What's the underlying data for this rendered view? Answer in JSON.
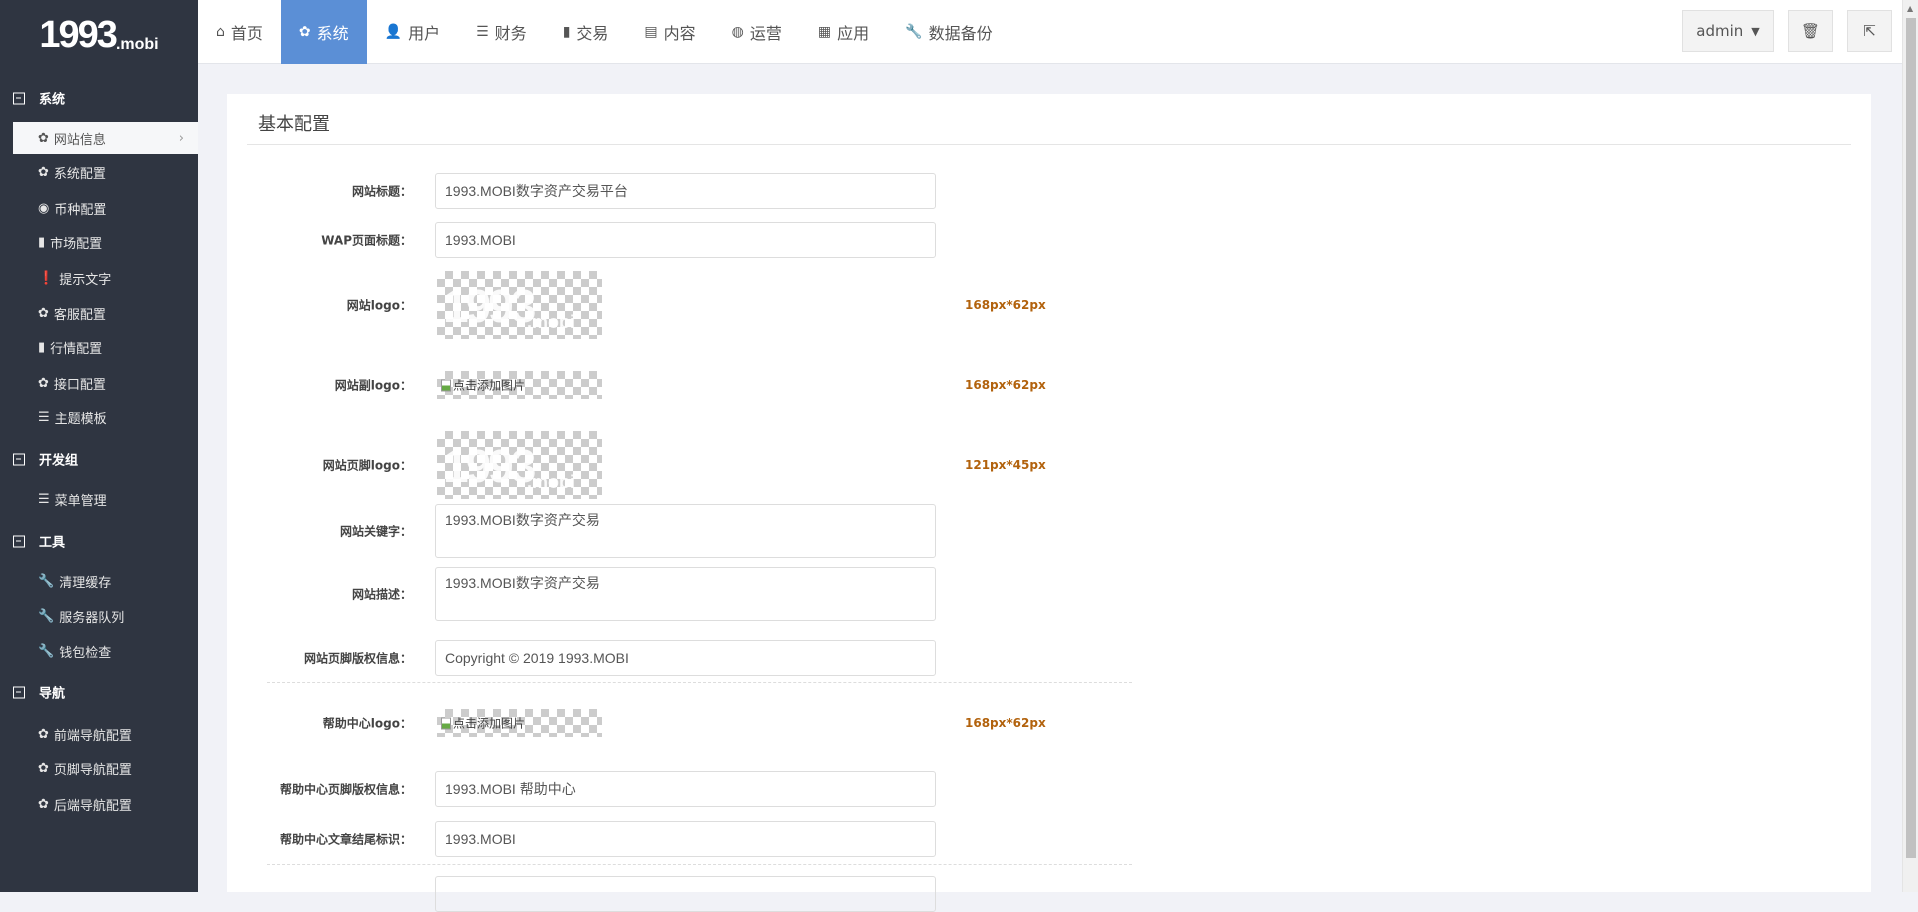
{
  "logo": {
    "big": "1993",
    "small": ".mobi"
  },
  "nav": [
    {
      "label": "首页",
      "icon": "home-icon",
      "glyph": "⌂"
    },
    {
      "label": "系统",
      "icon": "gear-icon",
      "glyph": "✿",
      "active": true
    },
    {
      "label": "用户",
      "icon": "user-icon",
      "glyph": "👤"
    },
    {
      "label": "财务",
      "icon": "list-icon",
      "glyph": "☰"
    },
    {
      "label": "交易",
      "icon": "bar-chart-icon",
      "glyph": "▮"
    },
    {
      "label": "内容",
      "icon": "document-icon",
      "glyph": "▤"
    },
    {
      "label": "运营",
      "icon": "globe-icon",
      "glyph": "◍"
    },
    {
      "label": "应用",
      "icon": "grid-icon",
      "glyph": "▦"
    },
    {
      "label": "数据备份",
      "icon": "wrench-icon",
      "glyph": "🔧"
    }
  ],
  "toolbar": {
    "user": "admin",
    "user_caret": "▼",
    "trash_glyph": "🗑",
    "logout_glyph": "⇱"
  },
  "sidebar": {
    "sections": [
      {
        "title": "系统",
        "items": [
          {
            "label": "网站信息",
            "glyph": "✿",
            "icon": "gear-icon",
            "active": true
          },
          {
            "label": "系统配置",
            "glyph": "✿",
            "icon": "gear-icon"
          },
          {
            "label": "币种配置",
            "glyph": "◉",
            "icon": "circle-icon"
          },
          {
            "label": "市场配置",
            "glyph": "▮",
            "icon": "bar-chart-icon"
          },
          {
            "label": "提示文字",
            "glyph": "❗",
            "icon": "exclamation-icon"
          },
          {
            "label": "客服配置",
            "glyph": "✿",
            "icon": "gear-icon"
          },
          {
            "label": "行情配置",
            "glyph": "▮",
            "icon": "bar-chart-icon"
          },
          {
            "label": "接口配置",
            "glyph": "✿",
            "icon": "gear-icon"
          },
          {
            "label": "主题模板",
            "glyph": "☰",
            "icon": "server-icon"
          }
        ]
      },
      {
        "title": "开发组",
        "items": [
          {
            "label": "菜单管理",
            "glyph": "☰",
            "icon": "list-icon"
          }
        ]
      },
      {
        "title": "工具",
        "items": [
          {
            "label": "清理缓存",
            "glyph": "🔧",
            "icon": "wrench-icon"
          },
          {
            "label": "服务器队列",
            "glyph": "🔧",
            "icon": "wrench-icon"
          },
          {
            "label": "钱包检查",
            "glyph": "🔧",
            "icon": "wrench-icon"
          }
        ]
      },
      {
        "title": "导航",
        "items": [
          {
            "label": "前端导航配置",
            "glyph": "✿",
            "icon": "gear-icon"
          },
          {
            "label": "页脚导航配置",
            "glyph": "✿",
            "icon": "gear-icon"
          },
          {
            "label": "后端导航配置",
            "glyph": "✿",
            "icon": "gear-icon"
          }
        ]
      }
    ]
  },
  "card": {
    "title": "基本配置"
  },
  "form": [
    {
      "label": "网站标题：",
      "type": "input",
      "value": "1993.MOBI数字资产交易平台"
    },
    {
      "label": "WAP页面标题：",
      "type": "input",
      "value": "1993.MOBI"
    },
    {
      "label": "网站logo：",
      "type": "logo",
      "hint": "168px*62px"
    },
    {
      "label": "网站副logo：",
      "type": "broken",
      "alt": "点击添加图片",
      "hint": "168px*62px"
    },
    {
      "label": "网站页脚logo：",
      "type": "logo",
      "hint": "121px*45px"
    },
    {
      "label": "网站关键字：",
      "type": "textarea",
      "value": "1993.MOBI数字资产交易"
    },
    {
      "label": "网站描述：",
      "type": "textarea",
      "value": "1993.MOBI数字资产交易"
    },
    {
      "label": "网站页脚版权信息：",
      "type": "input",
      "value": "Copyright © 2019  1993.MOBI"
    },
    {
      "label": "帮助中心logo：",
      "type": "broken",
      "alt": "点击添加图片",
      "hint": "168px*62px"
    },
    {
      "label": "帮助中心页脚版权信息：",
      "type": "input",
      "value": "1993.MOBI 帮助中心"
    },
    {
      "label": "帮助中心文章结尾标识：",
      "type": "input",
      "value": "1993.MOBI"
    },
    {
      "label": "",
      "type": "input",
      "value": ""
    }
  ]
}
